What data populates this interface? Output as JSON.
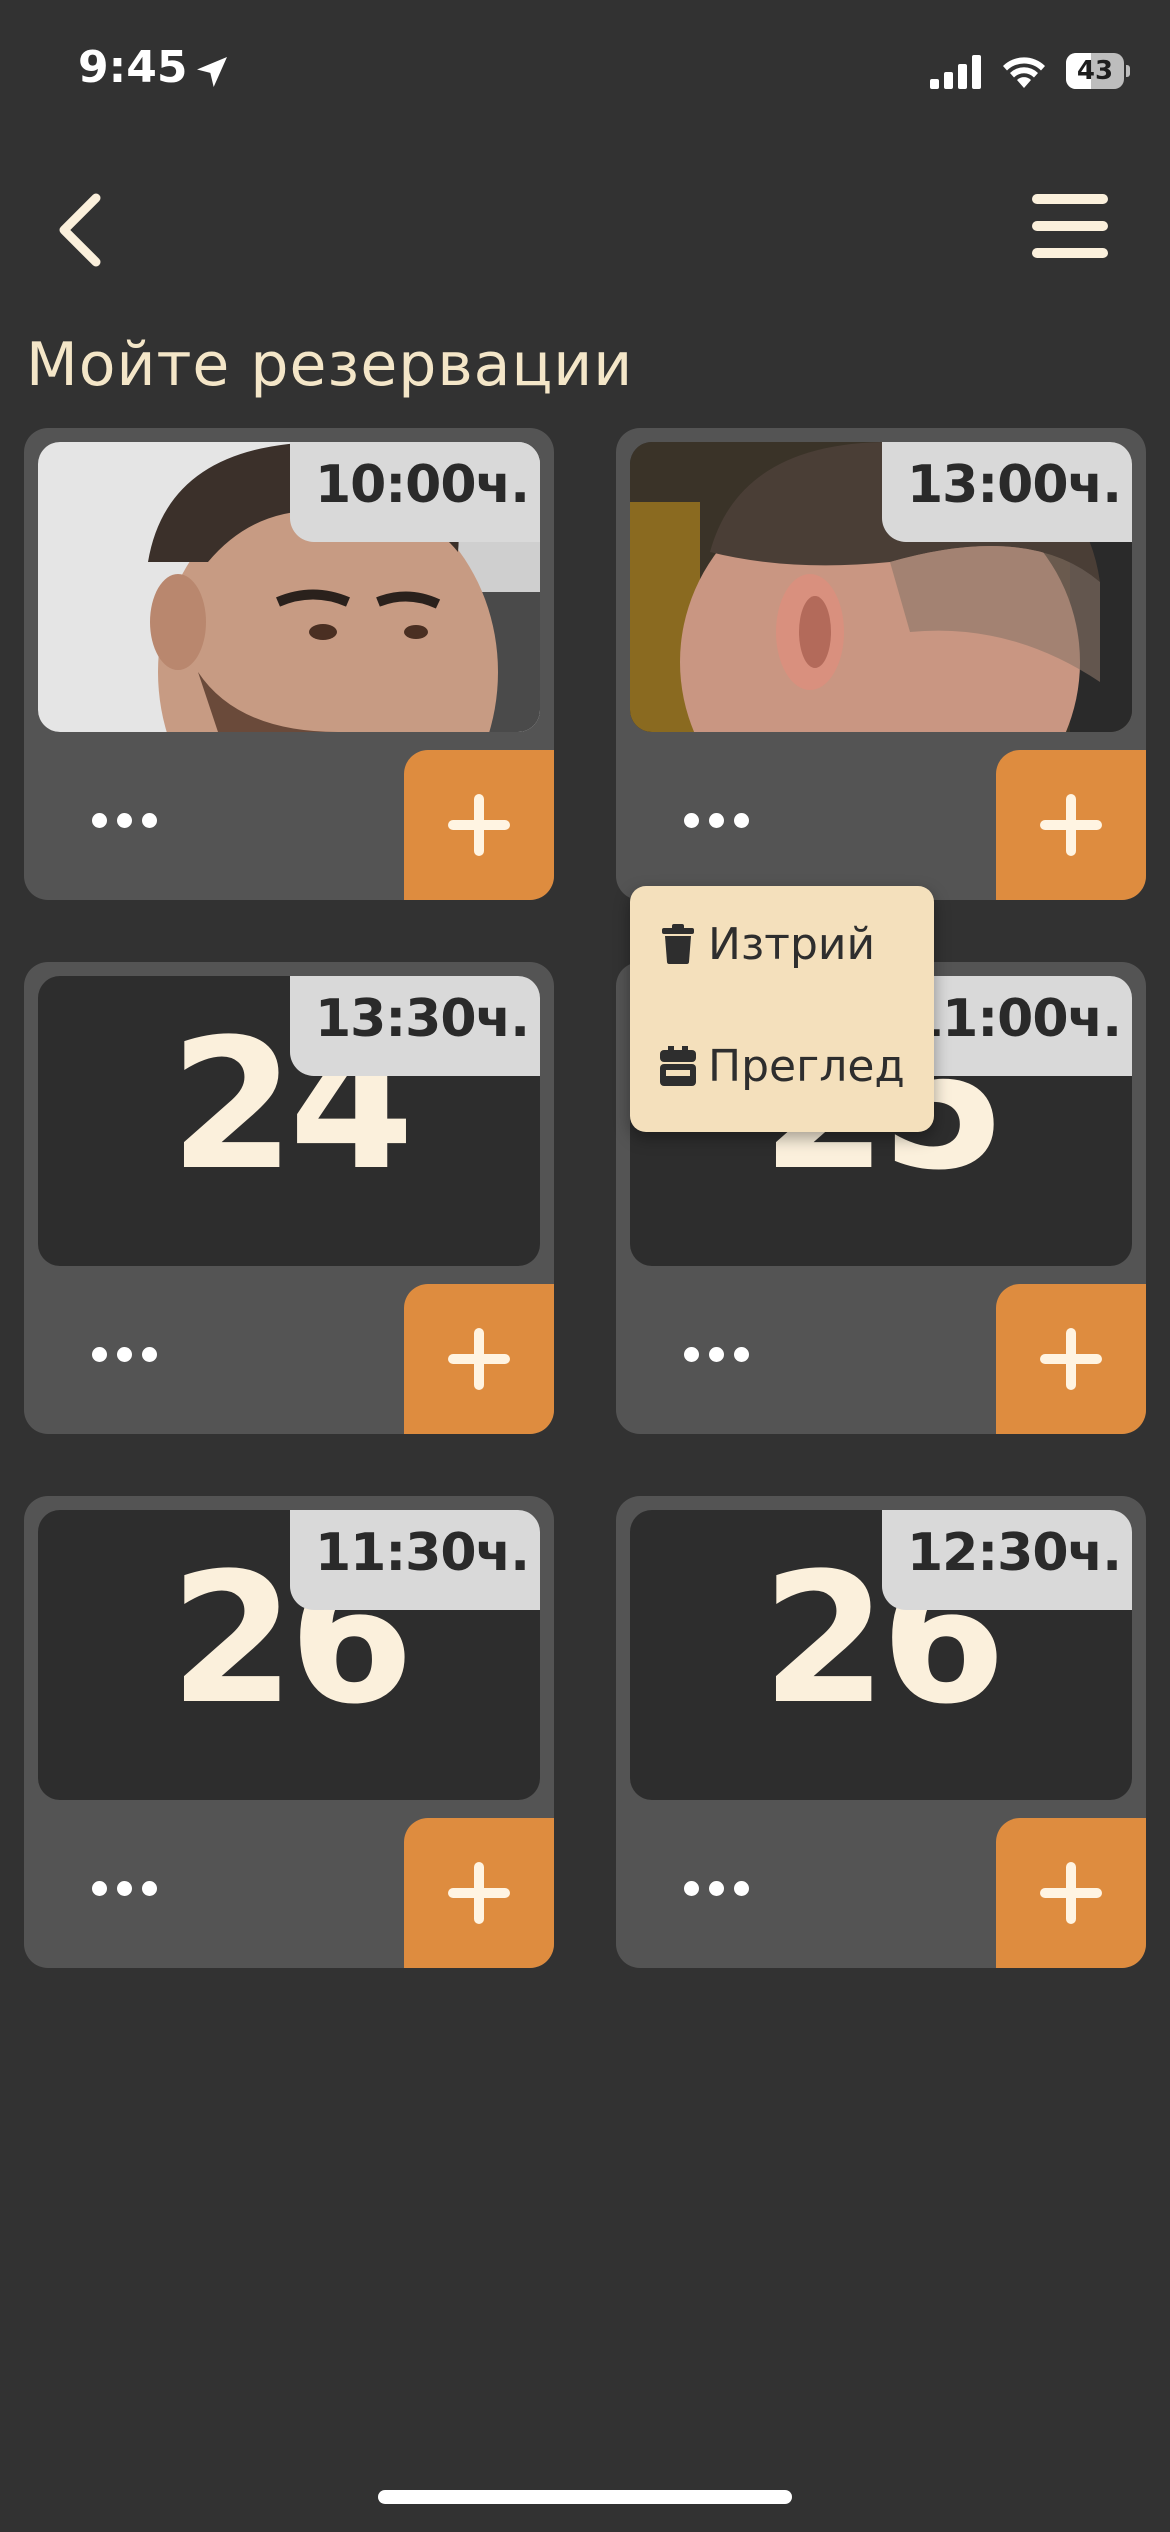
{
  "status_bar": {
    "time": "9:45",
    "battery_percent": "43",
    "battery_level": 0.43
  },
  "header": {
    "back_icon": "chevron-left-icon",
    "menu_icon": "hamburger-menu-icon"
  },
  "page": {
    "title": "Мойте резервации"
  },
  "reservations": [
    {
      "time": "10:00ч.",
      "has_photo": true,
      "photo": "haircut-photo-front"
    },
    {
      "time": "13:00ч.",
      "has_photo": true,
      "photo": "haircut-photo-back"
    },
    {
      "time": "13:30ч.",
      "day": "24"
    },
    {
      "time": "11:00ч.",
      "day": "25"
    },
    {
      "time": "11:30ч.",
      "day": "26"
    },
    {
      "time": "12:30ч.",
      "day": "26"
    }
  ],
  "context_menu": {
    "items": [
      {
        "label": "Изтрий",
        "icon": "trash-icon"
      },
      {
        "label": "Преглед",
        "icon": "calendar-icon"
      }
    ]
  },
  "colors": {
    "background": "#323232",
    "card": "#545454",
    "accent": "#de8c3f",
    "title": "#f4e6c8",
    "popup": "#f4e0bc",
    "badge": "#d9d9d9"
  }
}
